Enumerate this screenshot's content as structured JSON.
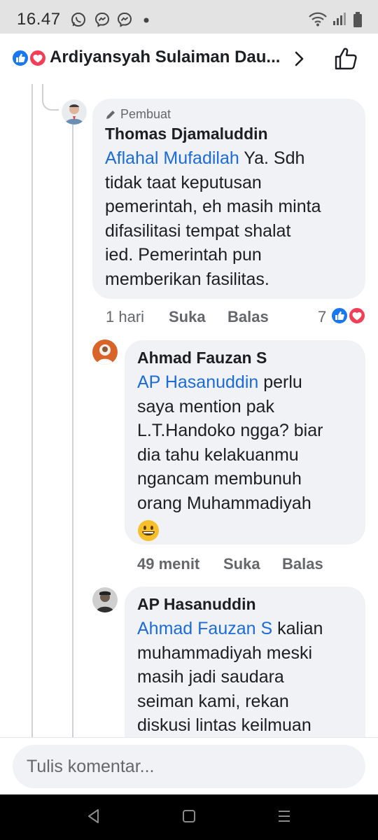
{
  "status_bar": {
    "time": "16.47"
  },
  "header": {
    "title": "Ardiyansyah Sulaiman Dau..."
  },
  "comments": [
    {
      "badge": "Pembuat",
      "author": "Thomas Djamaluddin",
      "mention": "Aflahal Mufadilah",
      "lines": [
        "Ya. Sdh",
        "tidak taat keputusan",
        "pemerintah, eh masih minta",
        "difasilitasi tempat shalat",
        "ied. Pemerintah pun",
        "memberikan fasilitas."
      ],
      "time": "1 hari",
      "like_label": "Suka",
      "reply_label": "Balas",
      "reaction_count": "7"
    },
    {
      "author": "Ahmad Fauzan S",
      "mention": "AP Hasanuddin",
      "lines": [
        "perlu",
        "saya mention pak",
        "L.T.Handoko ngga? biar",
        "dia tahu kelakuanmu",
        "ngancam membunuh",
        "orang Muhammadiyah"
      ],
      "emoji": "grinning-face",
      "time": "49 menit",
      "like_label": "Suka",
      "reply_label": "Balas"
    },
    {
      "author": "AP Hasanuddin",
      "mention": "Ahmad Fauzan S",
      "lines": [
        "kalian",
        "muhammadiyah meski",
        "masih jadi saudara",
        "seiman kami, rekan",
        "diskusi lintas keilmuan"
      ]
    }
  ],
  "composer": {
    "placeholder": "Tulis komentar..."
  },
  "colors": {
    "link": "#1b6bd9",
    "bubble": "#f0f2f5",
    "meta": "#65676b",
    "like_blue": "#1877f2",
    "love_red": "#f33e58"
  },
  "icons": {
    "status": [
      "whatsapp-icon",
      "messenger-icon",
      "messenger-icon",
      "dot-icon",
      "wifi-icon",
      "signal-icon",
      "battery-icon"
    ],
    "nav": [
      "back-icon",
      "home-icon",
      "recents-icon"
    ]
  }
}
